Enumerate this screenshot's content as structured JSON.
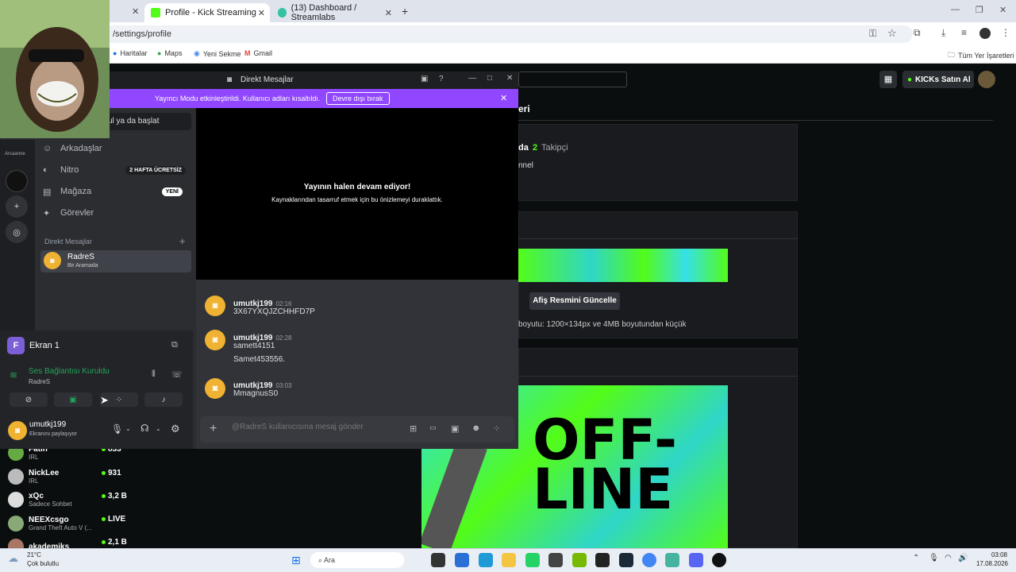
{
  "browser": {
    "tabs": [
      {
        "label": "Profile - Kick Streaming",
        "active": true
      },
      {
        "label": "(13) Dashboard / Streamlabs",
        "active": false
      }
    ],
    "new_tab": "+",
    "url": "/settings/profile",
    "bookmarks": [
      "Haritalar",
      "Maps",
      "Yeni Sekme",
      "Gmail"
    ],
    "bookmarks_right": "Tüm Yer İşaretleri"
  },
  "kick": {
    "kicks_button": "KICKs Satın Al",
    "section_title": "eri",
    "followers_prefix": "da",
    "followers_count": "2",
    "followers_label": "Takipçi",
    "channel_text": "nnel",
    "banner_button": "Afiş Resmini Güncelle",
    "banner_hint": "boyutu: 1200×134px ve 4MB boyutundan küçük",
    "offline_text": "OFF- LINE",
    "sidebar_users": [
      {
        "name": "Fatih",
        "category": "IRL",
        "viewers": "833"
      },
      {
        "name": "NickLee",
        "category": "IRL",
        "viewers": "931"
      },
      {
        "name": "xQc",
        "category": "Sadece Sohbet",
        "viewers": "3,2 B"
      },
      {
        "name": "NEEXcsgo",
        "category": "Grand Theft Auto V (...",
        "viewers": "LIVE"
      },
      {
        "name": "akademiks",
        "category": "",
        "viewers": "2,1 B"
      }
    ]
  },
  "discord": {
    "window_title": "Direkt Mesajlar",
    "streamer_banner": "Yayıncı Modu etkinleştirildi. Kullanıcı adları kısaltıldı.",
    "streamer_button": "Devre dışı bırak",
    "search_partial": "ul ya da başlat",
    "video_title": "Yayının halen devam ediyor!",
    "video_sub": "Kaynaklarından tasarruf etmek için bu önizlemeyi duraklattık.",
    "nav": [
      {
        "label": "Arkadaşlar"
      },
      {
        "label": "Nitro",
        "badge": "2 HAFTA ÜCRETSİZ"
      },
      {
        "label": "Mağaza",
        "badge": "YENİ"
      },
      {
        "label": "Görevler"
      }
    ],
    "dm_header": "Direkt Mesajlar",
    "dm_add": "+",
    "dm_user": {
      "name": "RadreS",
      "status": "Bir Aramada"
    },
    "guild_label": "Arcaanne",
    "messages": [
      {
        "user": "umutkj199",
        "time": "02:16",
        "lines": [
          "3X67YXQJZCHHFD7P"
        ]
      },
      {
        "user": "umutkj199",
        "time": "02:28",
        "lines": [
          "samett4151",
          "Samet453556."
        ]
      },
      {
        "user": "umutkj199",
        "time": "03:03",
        "lines": [
          "MmagnusS0"
        ]
      }
    ],
    "input_placeholder": "@RadreS kullanıcısına mesaj gönder",
    "screen": {
      "initial": "F",
      "label": "Ekran 1"
    },
    "voice": {
      "status": "Ses Bağlantısı Kuruldu",
      "channel": "RadreS"
    },
    "self": {
      "name": "umutkj199",
      "status": "Ekranını paylaşıyor"
    }
  },
  "taskbar": {
    "weather_temp": "21°C",
    "weather_desc": "Çok bulutlu",
    "search": "Ara",
    "time": "03:08",
    "date": "17.08.2026"
  }
}
